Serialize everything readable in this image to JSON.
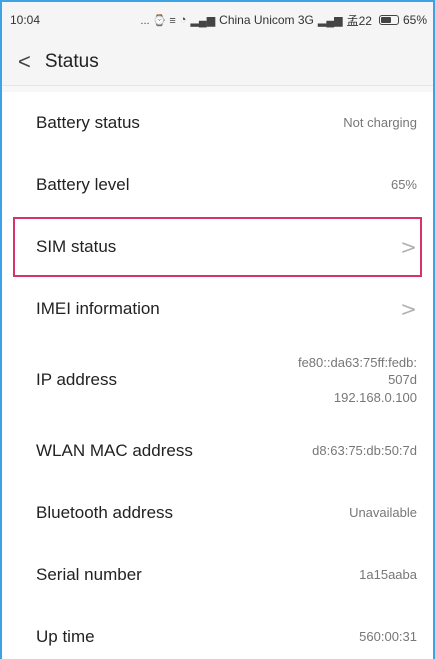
{
  "status_bar": {
    "time": "10:04",
    "indicators": "... ⌚ ≡",
    "carrier": "China Unicom 3G",
    "extra": "孟22",
    "battery_percent": "65%",
    "battery_level": 0.65
  },
  "header": {
    "title": "Status"
  },
  "rows": [
    {
      "label": "Battery status",
      "value": "Not charging"
    },
    {
      "label": "Battery level",
      "value": "65%"
    },
    {
      "label": "SIM status",
      "chevron": ">"
    },
    {
      "label": "IMEI information",
      "chevron": ">"
    },
    {
      "label": "IP address",
      "value_lines": [
        "fe80::da63:75ff:fedb:",
        "507d",
        "192.168.0.100"
      ]
    },
    {
      "label": "WLAN MAC address",
      "value": "d8:63:75:db:50:7d"
    },
    {
      "label": "Bluetooth address",
      "value": "Unavailable"
    },
    {
      "label": "Serial number",
      "value": "1a15aaba"
    },
    {
      "label": "Up time",
      "value": "560:00:31"
    }
  ],
  "colors": {
    "frame_border": "#3ea3e6",
    "highlight": "#d6336c"
  },
  "icons": [
    "back-arrow-icon",
    "chevron-right-icon",
    "battery-icon",
    "wifi-icon",
    "signal-icon"
  ]
}
